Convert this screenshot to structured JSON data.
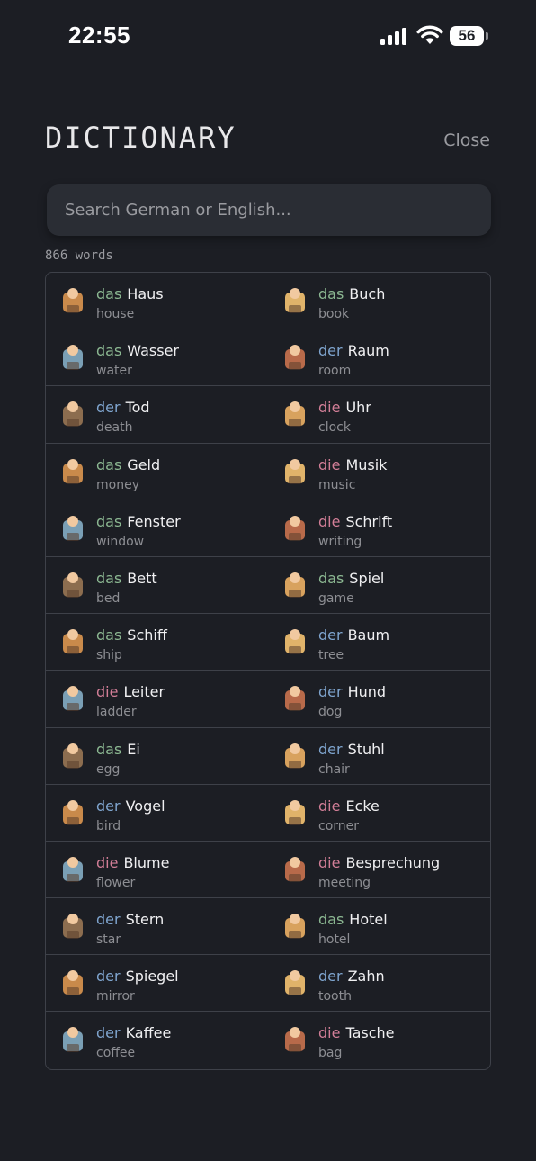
{
  "status": {
    "time": "22:55",
    "battery": "56"
  },
  "header": {
    "title": "DICTIONARY",
    "close_label": "Close"
  },
  "search": {
    "placeholder": "Search German or English..."
  },
  "summary": {
    "count_label": "866 words"
  },
  "colors": {
    "das": "#8cb892",
    "der": "#7fa5cf",
    "die": "#d27e97",
    "background": "#1c1e24"
  },
  "words": [
    {
      "article": "das",
      "noun": "Haus",
      "english": "house",
      "icon": "house-icon"
    },
    {
      "article": "das",
      "noun": "Buch",
      "english": "book",
      "icon": "book-icon"
    },
    {
      "article": "das",
      "noun": "Wasser",
      "english": "water",
      "icon": "water-icon"
    },
    {
      "article": "der",
      "noun": "Raum",
      "english": "room",
      "icon": "room-icon"
    },
    {
      "article": "der",
      "noun": "Tod",
      "english": "death",
      "icon": "coffin-icon"
    },
    {
      "article": "die",
      "noun": "Uhr",
      "english": "clock",
      "icon": "clock-icon"
    },
    {
      "article": "das",
      "noun": "Geld",
      "english": "money",
      "icon": "money-icon"
    },
    {
      "article": "die",
      "noun": "Musik",
      "english": "music",
      "icon": "harp-icon"
    },
    {
      "article": "das",
      "noun": "Fenster",
      "english": "window",
      "icon": "window-icon"
    },
    {
      "article": "die",
      "noun": "Schrift",
      "english": "writing",
      "icon": "writing-icon"
    },
    {
      "article": "das",
      "noun": "Bett",
      "english": "bed",
      "icon": "bed-icon"
    },
    {
      "article": "das",
      "noun": "Spiel",
      "english": "game",
      "icon": "game-icon"
    },
    {
      "article": "das",
      "noun": "Schiff",
      "english": "ship",
      "icon": "ship-icon"
    },
    {
      "article": "der",
      "noun": "Baum",
      "english": "tree",
      "icon": "tree-icon"
    },
    {
      "article": "die",
      "noun": "Leiter",
      "english": "ladder",
      "icon": "ladder-icon"
    },
    {
      "article": "der",
      "noun": "Hund",
      "english": "dog",
      "icon": "dog-icon"
    },
    {
      "article": "das",
      "noun": "Ei",
      "english": "egg",
      "icon": "egg-icon"
    },
    {
      "article": "der",
      "noun": "Stuhl",
      "english": "chair",
      "icon": "chair-icon"
    },
    {
      "article": "der",
      "noun": "Vogel",
      "english": "bird",
      "icon": "bird-icon"
    },
    {
      "article": "die",
      "noun": "Ecke",
      "english": "corner",
      "icon": "corner-icon"
    },
    {
      "article": "die",
      "noun": "Blume",
      "english": "flower",
      "icon": "flower-icon"
    },
    {
      "article": "die",
      "noun": "Besprechung",
      "english": "meeting",
      "icon": "meeting-icon"
    },
    {
      "article": "der",
      "noun": "Stern",
      "english": "star",
      "icon": "star-icon"
    },
    {
      "article": "das",
      "noun": "Hotel",
      "english": "hotel",
      "icon": "hotel-icon"
    },
    {
      "article": "der",
      "noun": "Spiegel",
      "english": "mirror",
      "icon": "mirror-icon"
    },
    {
      "article": "der",
      "noun": "Zahn",
      "english": "tooth",
      "icon": "tooth-icon"
    },
    {
      "article": "der",
      "noun": "Kaffee",
      "english": "coffee",
      "icon": "coffee-icon"
    },
    {
      "article": "die",
      "noun": "Tasche",
      "english": "bag",
      "icon": "bag-icon"
    }
  ]
}
